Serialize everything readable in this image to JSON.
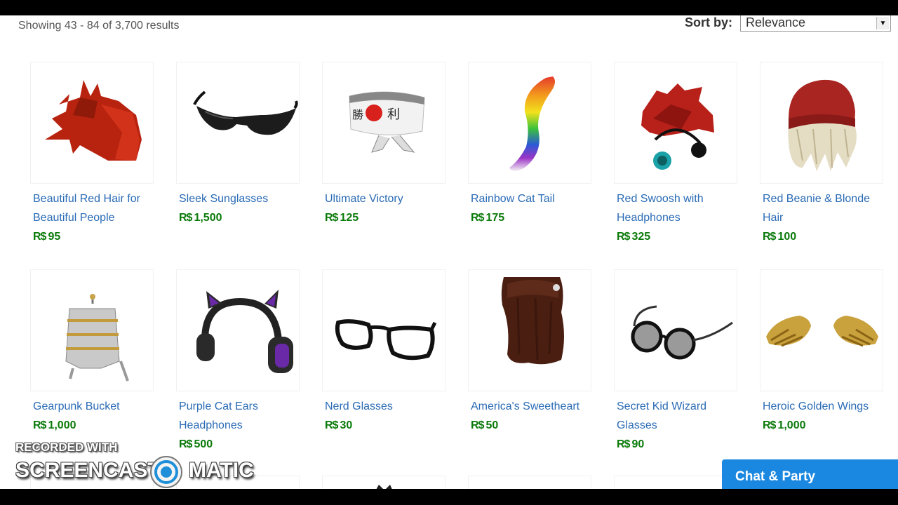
{
  "results": {
    "text": "Showing 43 - 84 of 3,700 results"
  },
  "sort": {
    "label": "Sort by:",
    "value": "Relevance"
  },
  "currency_symbol": "R$",
  "items": [
    {
      "name": "Beautiful Red Hair for Beautiful People",
      "price": "95",
      "icon": "red-spiky-hair-icon"
    },
    {
      "name": "Sleek Sunglasses",
      "price": "1,500",
      "icon": "sunglasses-icon"
    },
    {
      "name": "Ultimate Victory",
      "price": "125",
      "icon": "headband-icon"
    },
    {
      "name": "Rainbow Cat Tail",
      "price": "175",
      "icon": "rainbow-tail-icon"
    },
    {
      "name": "Red Swoosh with Headphones",
      "price": "325",
      "icon": "red-hair-headphones-icon"
    },
    {
      "name": "Red Beanie & Blonde Hair",
      "price": "100",
      "icon": "beanie-blonde-hair-icon"
    },
    {
      "name": "Gearpunk Bucket",
      "price": "1,000",
      "icon": "gearpunk-bucket-icon"
    },
    {
      "name": "Purple Cat Ears Headphones",
      "price": "500",
      "icon": "cat-ears-headphones-icon"
    },
    {
      "name": "Nerd Glasses",
      "price": "30",
      "icon": "nerd-glasses-icon"
    },
    {
      "name": "America's Sweetheart",
      "price": "50",
      "icon": "brown-hair-icon"
    },
    {
      "name": "Secret Kid Wizard Glasses",
      "price": "90",
      "icon": "round-glasses-icon"
    },
    {
      "name": "Heroic Golden Wings",
      "price": "1,000",
      "icon": "golden-wings-icon"
    }
  ],
  "watermark": {
    "line1": "RECORDED WITH",
    "line2a": "SCREENCAST",
    "line2b": "MATIC"
  },
  "chat": {
    "label": "Chat & Party"
  },
  "colors": {
    "link": "#2a6bb5",
    "price": "#0a7a0a",
    "chat_bg": "#1a88e0"
  }
}
